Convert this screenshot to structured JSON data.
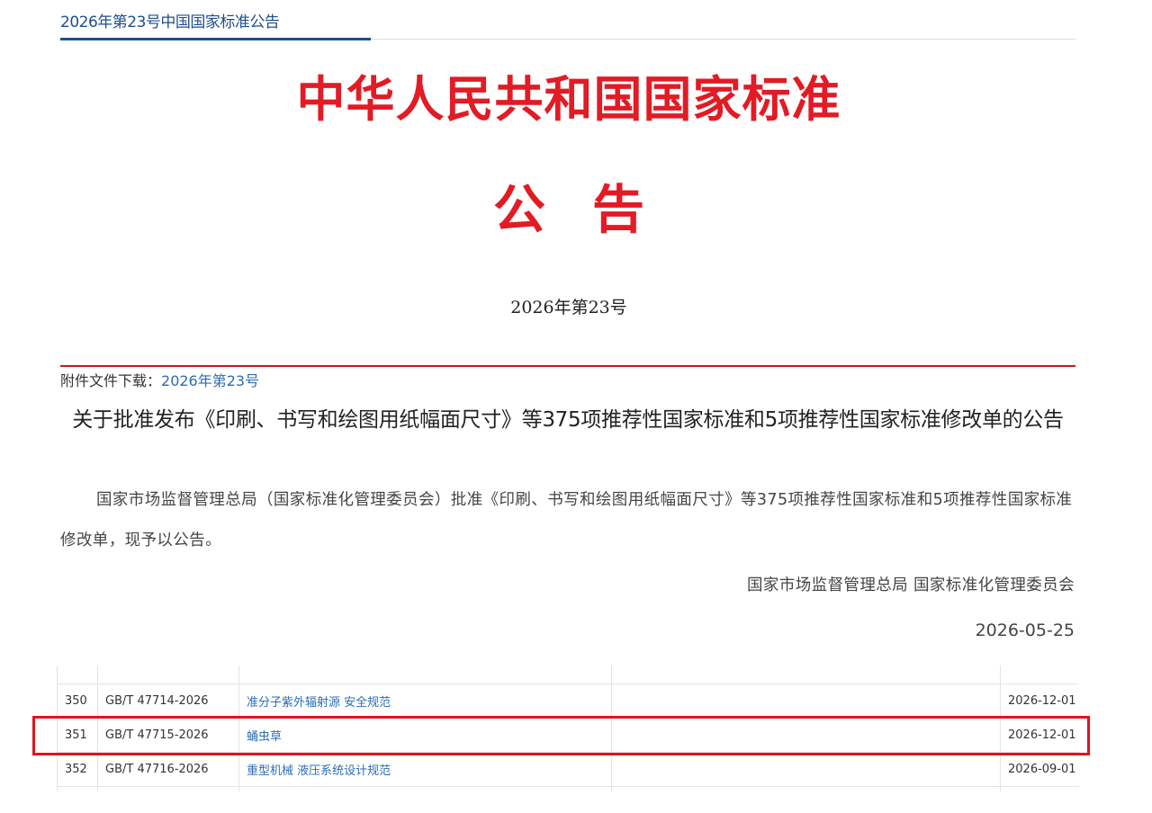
{
  "breadcrumb": {
    "text": "2026年第23号中国国家标准公告"
  },
  "header": {
    "title": "中华人民共和国国家标准",
    "subtitle": "公告",
    "issue": "2026年第23号"
  },
  "attachment": {
    "label": "附件文件下载：",
    "link_text": "2026年第23号"
  },
  "article": {
    "headline": "关于批准发布《印刷、书写和绘图用纸幅面尺寸》等375项推荐性国家标准和5项推荐性国家标准修改单的公告",
    "body": "国家市场监督管理总局（国家标准化管理委员会）批准《印刷、书写和绘图用纸幅面尺寸》等375项推荐性国家标准和5项推荐性国家标准修改单，现予以公告。",
    "signature_org": "国家市场监督管理总局 国家标准化管理委员会",
    "signature_date": "2026-05-25"
  },
  "table": {
    "rows": [
      {
        "no": "350",
        "code": "GB/T 47714-2026",
        "name": "准分子紫外辐射源 安全规范",
        "replaces": "",
        "date": "2026-12-01"
      },
      {
        "no": "351",
        "code": "GB/T 47715-2026",
        "name": "蛹虫草",
        "replaces": "",
        "date": "2026-12-01"
      },
      {
        "no": "352",
        "code": "GB/T 47716-2026",
        "name": "重型机械 液压系统设计规范",
        "replaces": "",
        "date": "2026-09-01"
      }
    ]
  },
  "colors": {
    "title_red": "#e21b25",
    "link_blue": "#2c6cb5",
    "highlight_red": "#e0141e",
    "nav_blue": "#1f4e8c"
  }
}
